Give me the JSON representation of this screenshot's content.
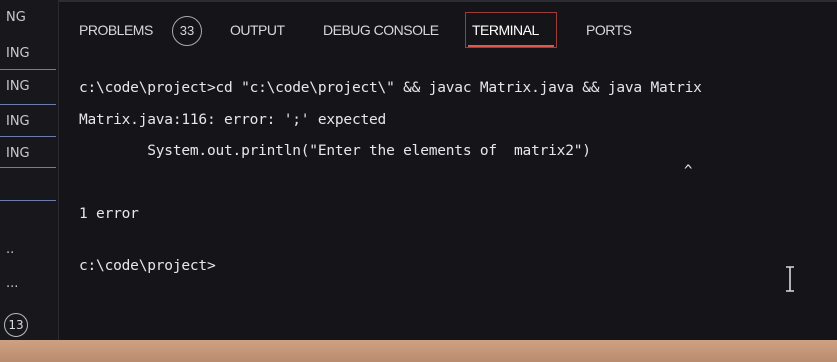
{
  "sidebar": {
    "items": [
      "NG",
      "ING",
      "ING",
      "ING",
      "ING"
    ],
    "dots": [
      "..",
      "..."
    ],
    "badge": "13"
  },
  "panel": {
    "tabs": [
      {
        "label": "PROBLEMS",
        "active": false
      },
      {
        "label": "OUTPUT",
        "active": false
      },
      {
        "label": "DEBUG CONSOLE",
        "active": false
      },
      {
        "label": "TERMINAL",
        "active": true
      },
      {
        "label": "PORTS",
        "active": false
      }
    ],
    "problems_count": "33"
  },
  "terminal": {
    "lines": [
      "c:\\code\\project>cd \"c:\\code\\project\\\" && javac Matrix.java && java Matrix",
      "Matrix.java:116: error: ';' expected",
      "        System.out.println(\"Enter the elements of  matrix2\")",
      "^",
      "1 error",
      "c:\\code\\project>"
    ]
  },
  "colors": {
    "accent_tab_underline": "#e2574c",
    "bottom_bar": "#cfa183",
    "background": "#151519"
  }
}
